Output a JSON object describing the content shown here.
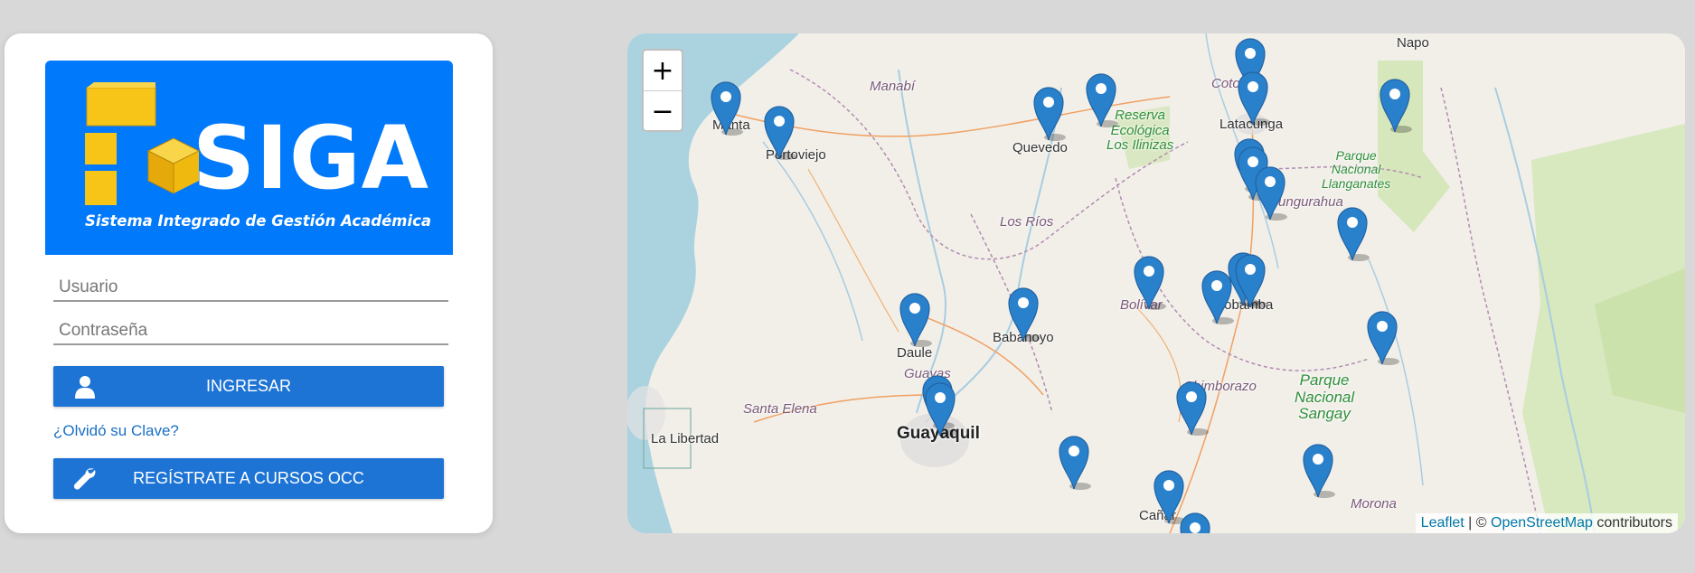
{
  "login": {
    "logo_word": "SIGA",
    "logo_subtitle": "Sistema Integrado de Gestión Académica",
    "user_placeholder": "Usuario",
    "password_placeholder": "Contraseña",
    "login_button": "INGRESAR",
    "forgot_link": "¿Olvidó su Clave?",
    "register_button": "REGÍSTRATE A CURSOS OCC",
    "login_icon": "user-icon",
    "register_icon": "wrench-icon"
  },
  "map": {
    "zoom_in": "+",
    "zoom_out": "−",
    "places": {
      "manta": "Manta",
      "portoviejo": "Portoviejo",
      "manabi": "Manabí",
      "quevedo": "Quevedo",
      "cotopaxi": "Cotopaxi",
      "latacunga": "Latacunga",
      "napo": "Napo",
      "reserva1": "Reserva",
      "reserva2": "Ecológica",
      "reserva3": "Los Ilinizas",
      "parque1": "Parque",
      "parque2": "Nacional",
      "parque3": "Llanganates",
      "tungurahua": "Tungurahua",
      "los_rios": "Los Ríos",
      "bolivar": "Bolívar",
      "riobamba": "Riobamba",
      "daule": "Daule",
      "babahoyo": "Babahoyo",
      "guayas": "Guayas",
      "santa_elena": "Santa Elena",
      "la_libertad": "La Libertad",
      "guayaquil": "Guayaquil",
      "chimborazo": "Chimborazo",
      "sangay1": "Parque",
      "sangay2": "Nacional",
      "sangay3": "Sangay",
      "morona": "Morona",
      "canar": "Cañar"
    },
    "attribution": {
      "leaflet": "Leaflet",
      "sep": " | © ",
      "osm": "OpenStreetMap",
      "contributors": " contributors"
    },
    "marker_icon": "map-marker-icon",
    "colors": {
      "marker": "#2a81cb",
      "water": "#aad3df",
      "land": "#f2efe9",
      "forest": "#c8e0a8"
    }
  }
}
